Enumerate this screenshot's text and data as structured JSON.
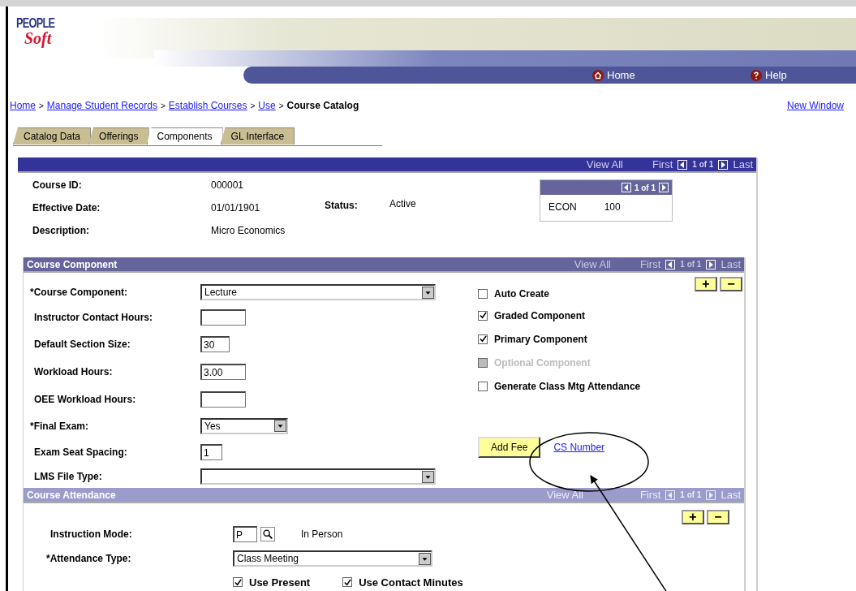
{
  "logo": {
    "line_1": "PEOPLE",
    "line_2": "Soft"
  },
  "nav": [
    {
      "label": "Home"
    },
    {
      "label": "Help"
    }
  ],
  "breadcrumb": [
    {
      "label": "Home",
      "link": true
    },
    {
      "label": "Manage Student Records",
      "link": true
    },
    {
      "label": "Establish Courses",
      "link": true
    },
    {
      "label": "Use",
      "link": true
    },
    {
      "label": "Course Catalog",
      "link": false
    }
  ],
  "breadcrumb_separator": ">",
  "new_window": "New Window",
  "tabs": [
    {
      "label": "Catalog Data",
      "selected": false
    },
    {
      "label": "Offerings",
      "selected": false
    },
    {
      "label": "Components",
      "selected": true
    },
    {
      "label": "GL Interface",
      "selected": false
    }
  ],
  "header_nav": {
    "view_all": "View All",
    "first": "First",
    "count": "1 of 1",
    "last": "Last"
  },
  "course_info": [
    {
      "label": "Course ID:",
      "value": "000001"
    },
    {
      "label": "Effective Date:",
      "value": "01/01/1901"
    },
    {
      "label": "Description:",
      "value": "Micro Economics"
    }
  ],
  "status": {
    "label": "Status:",
    "value": "Active"
  },
  "subject_box": {
    "count": "1 of 1",
    "subject": "ECON",
    "number": "100"
  },
  "course_component": {
    "title": "Course Component",
    "nav": {
      "view_all": "View All",
      "first": "First",
      "count": "1 of 1",
      "last": "Last"
    },
    "fields": [
      {
        "label": "*Course Component:",
        "kind": "dropdown-wide",
        "value": "Lecture"
      },
      {
        "label": "Instructor Contact Hours:",
        "kind": "input-medium"
      },
      {
        "label": "Default Section Size:",
        "kind": "input-small",
        "value": "30"
      },
      {
        "label": "Workload Hours:",
        "kind": "input-medium",
        "value": "3.00"
      },
      {
        "label": "OEE Workload Hours:",
        "kind": "input-medium"
      },
      {
        "label": "*Final Exam:",
        "kind": "dropdown-narrow",
        "value": "Yes"
      },
      {
        "label": "Exam Seat Spacing:",
        "kind": "input-tiny",
        "value": "1"
      },
      {
        "label": "LMS File Type:",
        "kind": "dropdown-wide"
      }
    ],
    "checkboxes": [
      {
        "label": "Auto Create",
        "checked": false,
        "disabled": false
      },
      {
        "label": "Graded Component",
        "checked": true,
        "disabled": false
      },
      {
        "label": "Primary Component",
        "checked": true,
        "disabled": false
      },
      {
        "label": "Optional Component",
        "checked": false,
        "disabled": true
      },
      {
        "label": "Generate Class Mtg Attendance",
        "checked": false,
        "disabled": false
      }
    ],
    "add_button": "+",
    "remove_button": "−",
    "fee_button": "Add Fee",
    "link": "CS Number"
  },
  "course_attendance": {
    "title": "Course Attendance",
    "nav": {
      "view_all": "View All",
      "first": "First",
      "count": "1 of 1",
      "last": "Last"
    },
    "add_button": "+",
    "remove_button": "−",
    "instruction_mode": {
      "label": "Instruction Mode:",
      "value": "P",
      "description": "In Person"
    },
    "attendance_type": {
      "label": "*Attendance Type:",
      "value": "Class Meeting"
    },
    "checkboxes": [
      {
        "label": "Use Present",
        "checked": true
      },
      {
        "label": "Use Contact Minutes",
        "checked": true
      }
    ]
  }
}
